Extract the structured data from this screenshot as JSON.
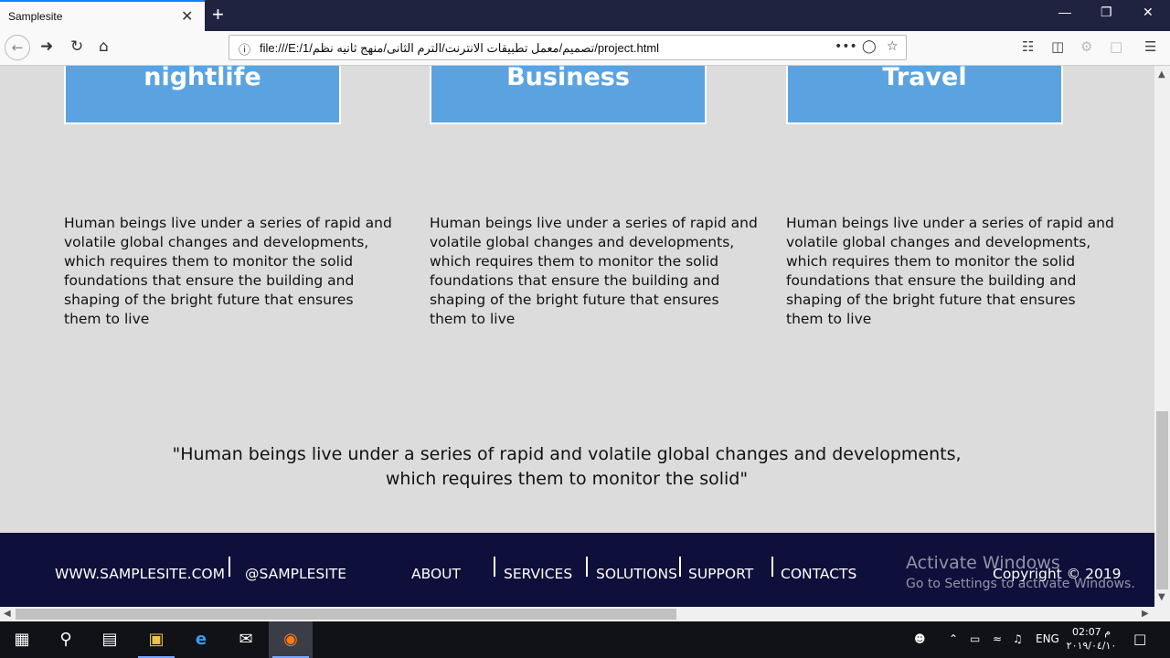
{
  "browser": {
    "tab_title": "Samplesite",
    "tab_close": "✕",
    "new_tab": "+",
    "url": "file:///E:/1/تصميم/معمل تطبيقات الانترنت/الترم الثانى/منهج ثانيه نظم/project.html",
    "page_actions": "•••",
    "window_minimize": "—",
    "window_restore": "❐",
    "window_close": "✕"
  },
  "cards": [
    {
      "title": "nightlife",
      "text": "Human beings live under a series of rapid and volatile global changes and developments, which requires them to monitor the solid foundations that ensure the building and shaping of the bright future that ensures them to live"
    },
    {
      "title": "Business",
      "text": "Human beings live under a series of rapid and volatile global changes and developments, which requires them to monitor the solid foundations that ensure the building and shaping of the bright future that ensures them to live"
    },
    {
      "title": "Travel",
      "text": "Human beings live under a series of rapid and volatile global changes and developments, which requires them to monitor the solid foundations that ensure the building and shaping of the bright future that ensures them to live"
    }
  ],
  "quote": "\"Human beings live under a series of rapid and volatile global changes and developments, which requires them to monitor the solid\"",
  "footer": {
    "website": "WWW.SAMPLESITE.COM",
    "handle": "@SAMPLESITE",
    "nav": [
      "ABOUT",
      "SERVICES",
      "SOLUTIONS",
      "SUPPORT",
      "CONTACTS"
    ],
    "copyright": "Copyright © 2019"
  },
  "watermark": {
    "line1": "Activate Windows",
    "line2": "Go to Settings to activate Windows."
  },
  "taskbar": {
    "language": "ENG",
    "time": "02:07 م",
    "date": "٢٠١٩/٠٤/١٠"
  },
  "colors": {
    "page_bg": "#dcdcdc",
    "card_bg": "#5ba3e0",
    "footer_bg": "#0e0f3a",
    "tabbar_bg": "#202340"
  }
}
